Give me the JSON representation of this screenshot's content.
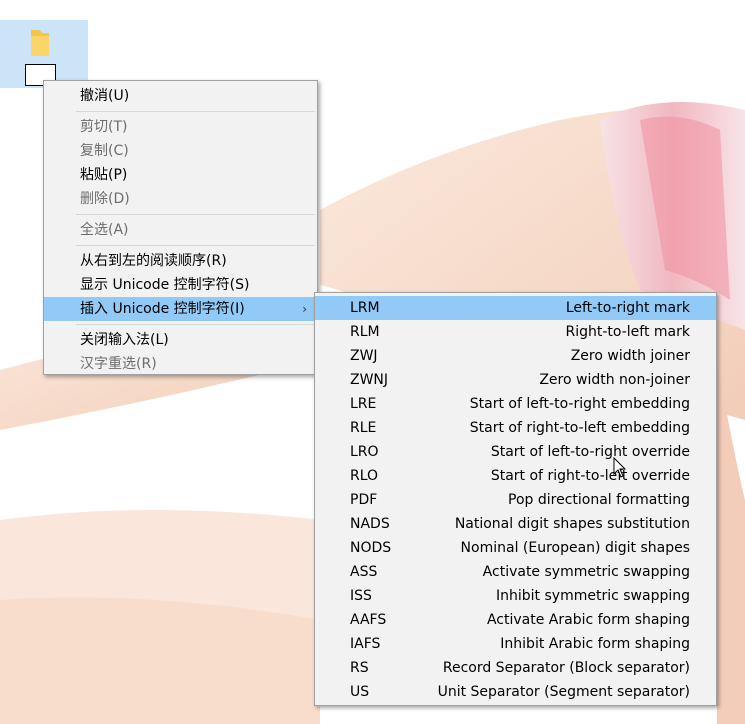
{
  "main_menu": {
    "items": [
      {
        "label": "撤消(U)",
        "disabled": false
      },
      {
        "label": "剪切(T)",
        "disabled": true
      },
      {
        "label": "复制(C)",
        "disabled": true
      },
      {
        "label": "粘贴(P)",
        "disabled": false
      },
      {
        "label": "删除(D)",
        "disabled": true
      },
      {
        "label": "全选(A)",
        "disabled": true
      },
      {
        "label": "从右到左的阅读顺序(R)",
        "disabled": false
      },
      {
        "label": "显示 Unicode 控制字符(S)",
        "disabled": false
      },
      {
        "label": "插入 Unicode 控制字符(I)",
        "disabled": false,
        "submenu_arrow": "›"
      },
      {
        "label": "关闭输入法(L)",
        "disabled": false
      },
      {
        "label": "汉字重选(R)",
        "disabled": true
      }
    ]
  },
  "sub_menu": {
    "items": [
      {
        "code": "LRM",
        "desc": "Left-to-right mark"
      },
      {
        "code": "RLM",
        "desc": "Right-to-left mark"
      },
      {
        "code": "ZWJ",
        "desc": "Zero width joiner"
      },
      {
        "code": "ZWNJ",
        "desc": "Zero width non-joiner"
      },
      {
        "code": "LRE",
        "desc": "Start of left-to-right embedding"
      },
      {
        "code": "RLE",
        "desc": "Start of right-to-left embedding"
      },
      {
        "code": "LRO",
        "desc": "Start of left-to-right override"
      },
      {
        "code": "RLO",
        "desc": "Start of right-to-left override"
      },
      {
        "code": "PDF",
        "desc": "Pop directional formatting"
      },
      {
        "code": "NADS",
        "desc": "National digit shapes substitution"
      },
      {
        "code": "NODS",
        "desc": "Nominal (European) digit shapes"
      },
      {
        "code": "ASS",
        "desc": "Activate symmetric swapping"
      },
      {
        "code": "ISS",
        "desc": "Inhibit symmetric swapping"
      },
      {
        "code": "AAFS",
        "desc": "Activate Arabic form shaping"
      },
      {
        "code": "IAFS",
        "desc": "Inhibit Arabic form shaping"
      },
      {
        "code": "RS",
        "desc": "Record Separator (Block separator)"
      },
      {
        "code": "US",
        "desc": "Unit Separator (Segment separator)"
      }
    ]
  },
  "colors": {
    "menu_bg": "#f2f2f2",
    "highlight": "#91c9f7",
    "disabled_text": "#6d6d6d",
    "selection_bg": "#cce4f7",
    "folder": "#f4c54b"
  },
  "icons": {
    "desktop": "folder-icon",
    "cursor": "mouse-pointer-icon"
  }
}
